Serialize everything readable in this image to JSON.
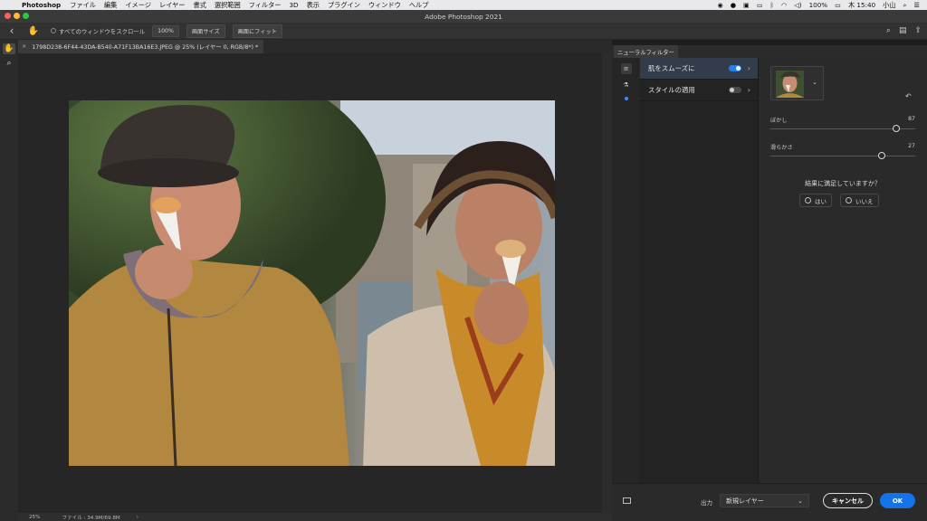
{
  "menubar": {
    "app_name": "Photoshop",
    "items": [
      "ファイル",
      "編集",
      "イメージ",
      "レイヤー",
      "書式",
      "選択範囲",
      "フィルター",
      "3D",
      "表示",
      "プラグイン",
      "ウィンドウ",
      "ヘルプ"
    ],
    "battery": "100%",
    "clock": "木 15:40",
    "user": "小山"
  },
  "window": {
    "title": "Adobe Photoshop 2021"
  },
  "options_bar": {
    "scroll_all_label": "すべてのウィンドウをスクロール",
    "zoom_100_label": "100%",
    "fit_screen_label": "画面サイズ",
    "fill_screen_label": "画面にフィット"
  },
  "document": {
    "tab_title": "1798D238-6F44-43DA-B540-A71F13BA16E3.JPEG @ 25% (レイヤー 0, RGB/8*) *",
    "zoom": "25%",
    "file_info": "ファイル : 34.9M/69.8M"
  },
  "neural_filters": {
    "panel_title": "ニューラルフィルター",
    "filters": [
      {
        "label": "肌をスムーズに",
        "enabled": true,
        "selected": true
      },
      {
        "label": "スタイルの適用",
        "enabled": false,
        "selected": false
      }
    ],
    "sliders": [
      {
        "label": "ぼかし",
        "value": "87",
        "level": 0.87
      },
      {
        "label": "滑らかさ",
        "value": "27",
        "level": 0.77
      }
    ],
    "feedback_question": "結果に満足していますか？",
    "feedback_yes": "はい",
    "feedback_no": "いいえ",
    "output_label": "出力",
    "output_value": "新規レイヤー",
    "cancel_label": "キャンセル",
    "ok_label": "OK"
  },
  "colors": {
    "accent": "#1473e6",
    "toggle_on": "#2680eb",
    "selected_row": "#323c4a"
  }
}
